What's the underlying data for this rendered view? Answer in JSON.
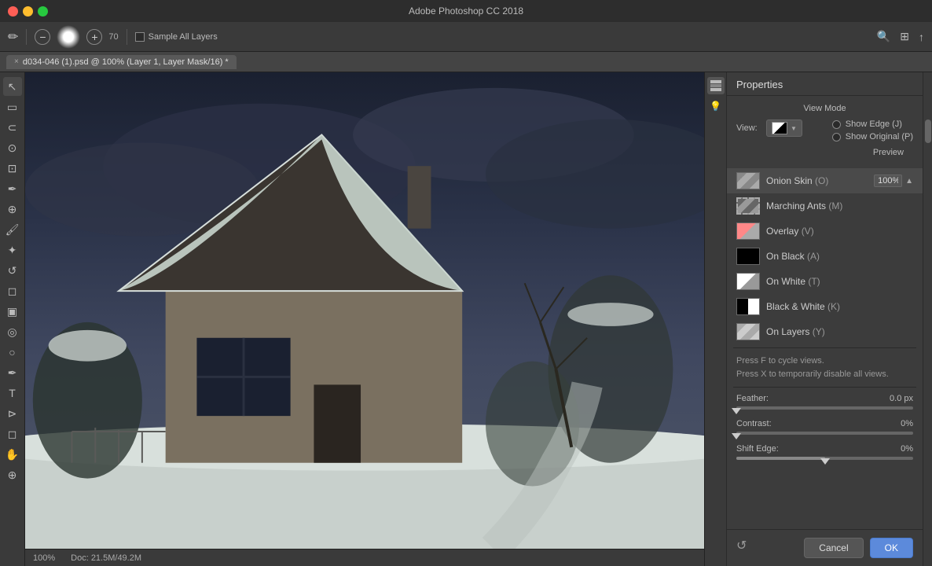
{
  "titleBar": {
    "title": "Adobe Photoshop CC 2018",
    "trafficLights": [
      "red",
      "yellow",
      "green"
    ]
  },
  "toolbar": {
    "brushSize": "70",
    "sampleAllLayersLabel": "Sample All Layers",
    "sampleAllLayersChecked": false
  },
  "tab": {
    "label": "d034-046 (1).psd @ 100% (Layer 1, Layer Mask/16) *",
    "closeLabel": "×"
  },
  "canvas": {
    "statusLeft": "100%",
    "statusDoc": "Doc: 21.5M/49.2M"
  },
  "propertiesPanel": {
    "title": "Properties",
    "viewMode": {
      "sectionLabel": "View Mode",
      "viewLabel": "View:",
      "showEdgeLabel": "Show Edge (J)",
      "showOriginalLabel": "Show Original (P)",
      "previewLabel": "Preview",
      "previewValue": "100%",
      "items": [
        {
          "name": "Onion Skin",
          "shortcut": "(O)",
          "thumbType": "onion"
        },
        {
          "name": "Marching Ants",
          "shortcut": "(M)",
          "thumbType": "marching"
        },
        {
          "name": "Overlay",
          "shortcut": "(V)",
          "thumbType": "overlay"
        },
        {
          "name": "On Black",
          "shortcut": "(A)",
          "thumbType": "onblack"
        },
        {
          "name": "On White",
          "shortcut": "(T)",
          "thumbType": "onwhite"
        },
        {
          "name": "Black & White",
          "shortcut": "(K)",
          "thumbType": "blackwhite"
        },
        {
          "name": "On Layers",
          "shortcut": "(Y)",
          "thumbType": "onlayers"
        }
      ]
    },
    "hints": {
      "line1": "Press F to cycle views.",
      "line2": "Press X to temporarily disable all views."
    },
    "feather": {
      "label": "Feather:",
      "value": "0.0 px",
      "percent": 0
    },
    "contrast": {
      "label": "Contrast:",
      "value": "0%",
      "percent": 0
    },
    "shiftEdge": {
      "label": "Shift Edge:",
      "value": "0%",
      "percent": 50
    },
    "buttons": {
      "cancel": "Cancel",
      "ok": "OK"
    }
  }
}
